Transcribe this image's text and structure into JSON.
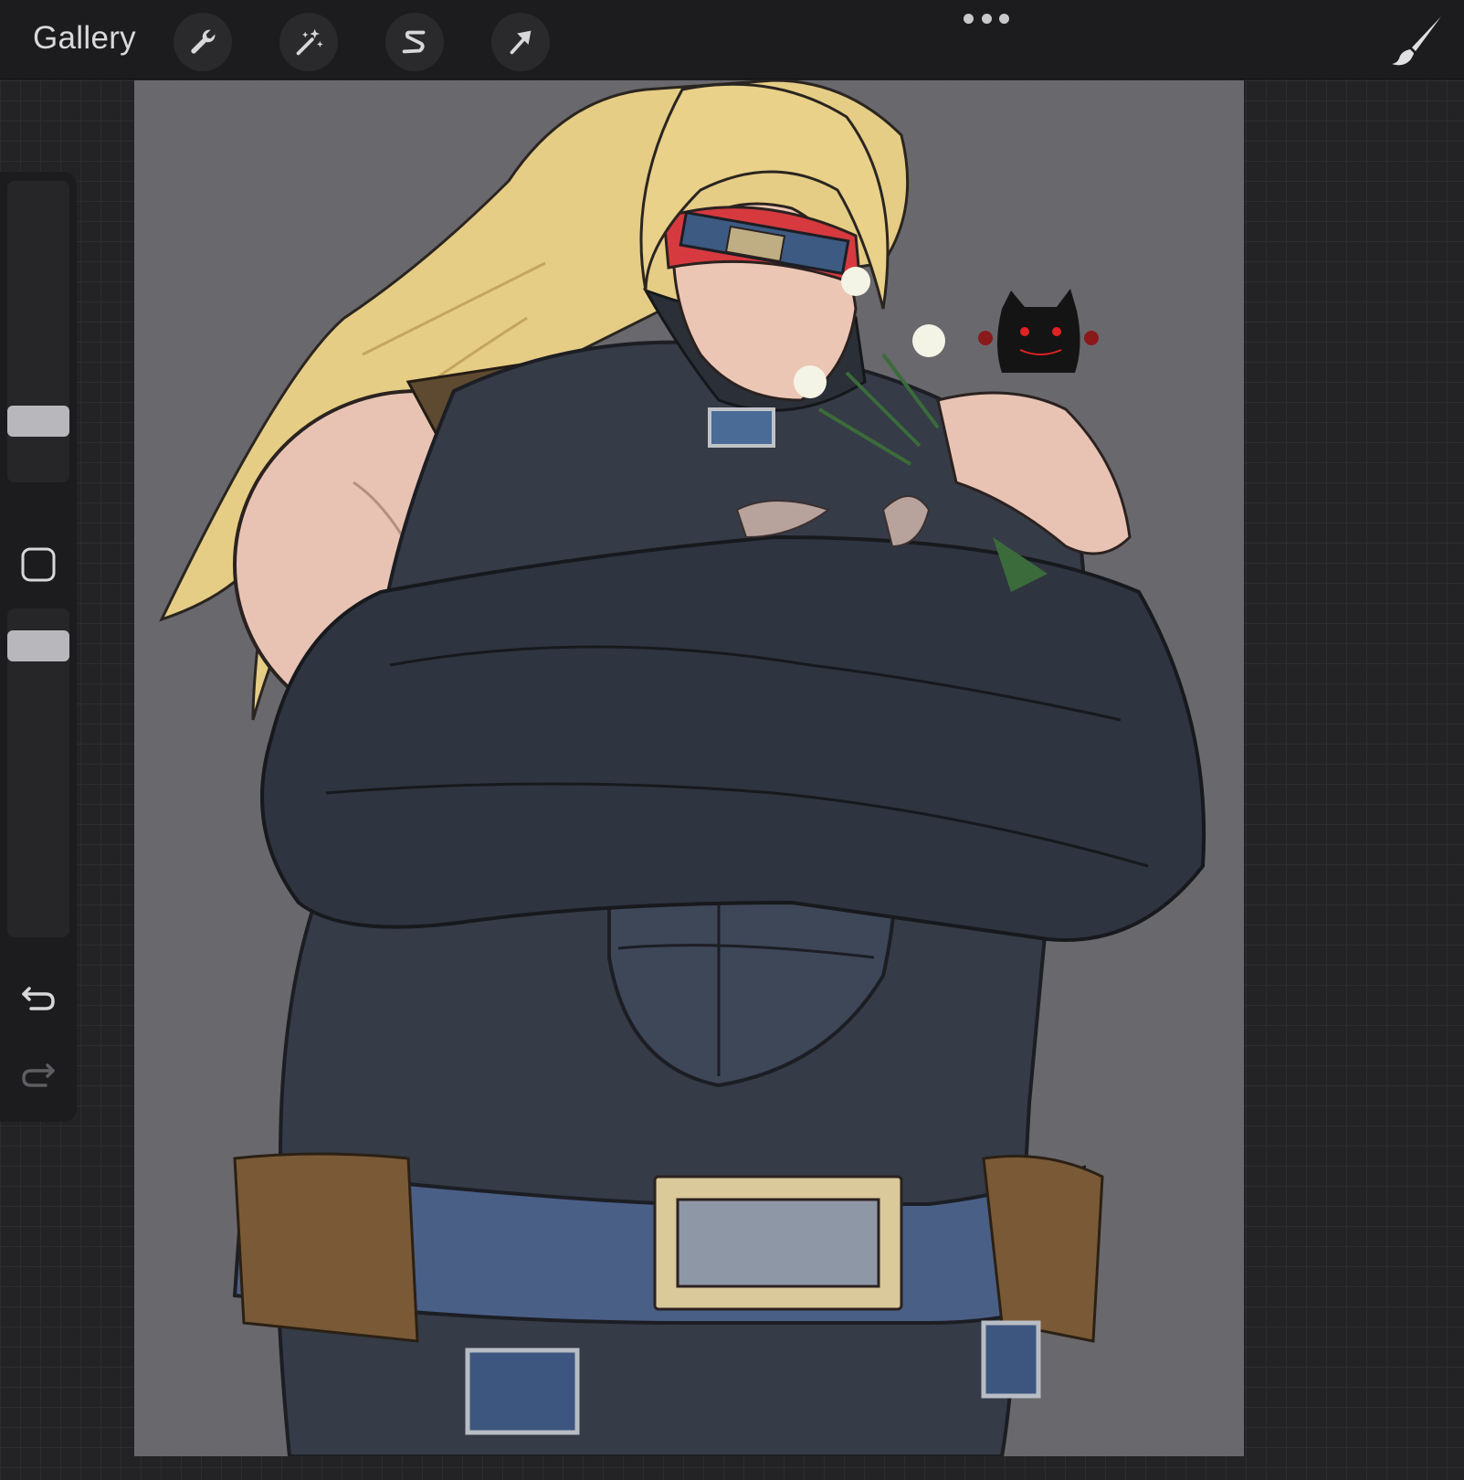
{
  "topbar": {
    "gallery_label": "Gallery",
    "tools": [
      {
        "name": "actions",
        "icon": "wrench-icon"
      },
      {
        "name": "adjustments",
        "icon": "magic-wand-icon"
      },
      {
        "name": "selection",
        "icon": "selection-s-icon"
      },
      {
        "name": "transform",
        "icon": "arrow-cursor-icon"
      }
    ],
    "more_icon": "ellipsis-icon",
    "brush_icon": "brush-icon"
  },
  "sidebar": {
    "brush_size_icon": "size-slider",
    "modify_icon": "square-icon",
    "opacity_icon": "opacity-slider",
    "undo_icon": "undo-icon",
    "redo_icon": "redo-icon"
  },
  "canvas": {
    "background_color": "#69686d",
    "content": "character-illustration"
  },
  "colors": {
    "ui_bar": "#1c1c1e",
    "ui_text": "#d9d9db",
    "hair": "#e9d18a",
    "skin": "#e8c3b4",
    "suit": "#3a4150",
    "belt": "#7a5a36",
    "headband_red": "#d63a3f"
  }
}
